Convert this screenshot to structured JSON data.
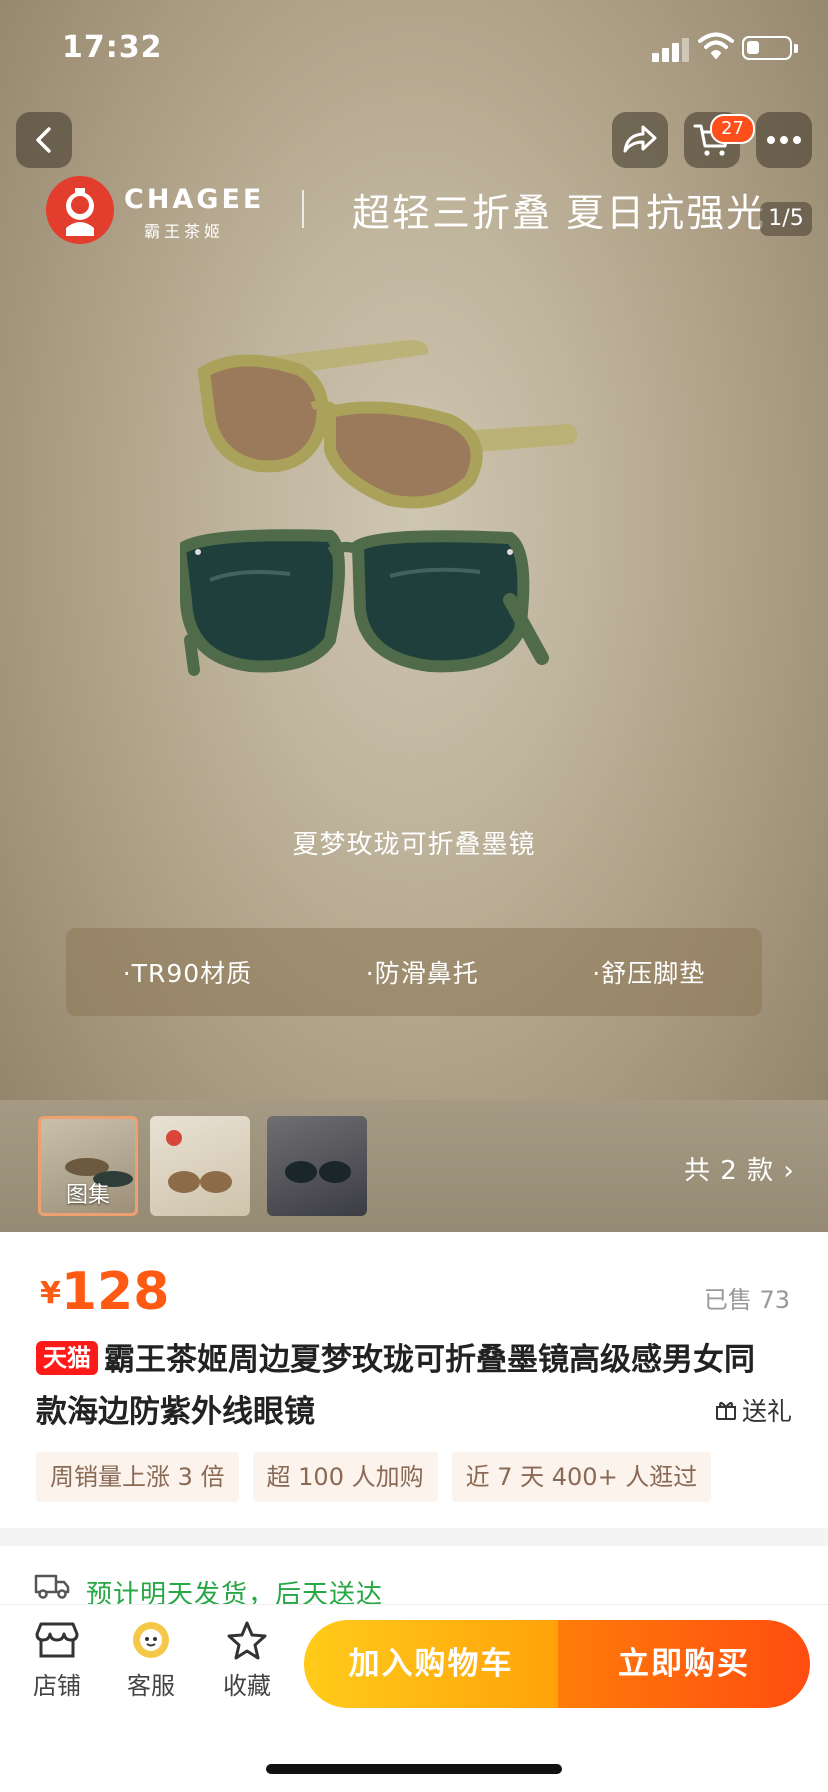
{
  "status_bar": {
    "time": "17:32"
  },
  "nav": {
    "cart_count": "27",
    "image_counter": "1/5"
  },
  "banner": {
    "brand_en": "CHAGEE",
    "brand_cn": "霸王茶姬",
    "slogan": "超轻三折叠 夏日抗强光",
    "product_caption": "夏梦玫珑可折叠墨镜",
    "features": [
      "·TR90材质",
      "·防滑鼻托",
      "·舒压脚垫"
    ]
  },
  "thumbnails": {
    "first_label": "图集",
    "styles_count": "共 2 款"
  },
  "product": {
    "currency": "¥",
    "price": "128",
    "sold": "已售 73",
    "tmall_badge": "天猫",
    "title": "霸王茶姬周边夏梦玫珑可折叠墨镜高级感男女同款海边防紫外线眼镜",
    "gift": "送礼",
    "tags": [
      "周销量上涨 3 倍",
      "超 100 人加购",
      "近 7 天 400+ 人逛过"
    ]
  },
  "shipping": {
    "text": "预计明天发货，后天送达"
  },
  "bottom_bar": {
    "store": "店铺",
    "service": "客服",
    "favorite": "收藏",
    "add_to_cart": "加入购物车",
    "buy_now": "立即购买"
  },
  "colors": {
    "price": "#ff5a14",
    "tmall": "#ff1a1a",
    "ship": "#28a745",
    "cart_btn": "#ffb20f",
    "buy_btn": "#ff5a10"
  }
}
